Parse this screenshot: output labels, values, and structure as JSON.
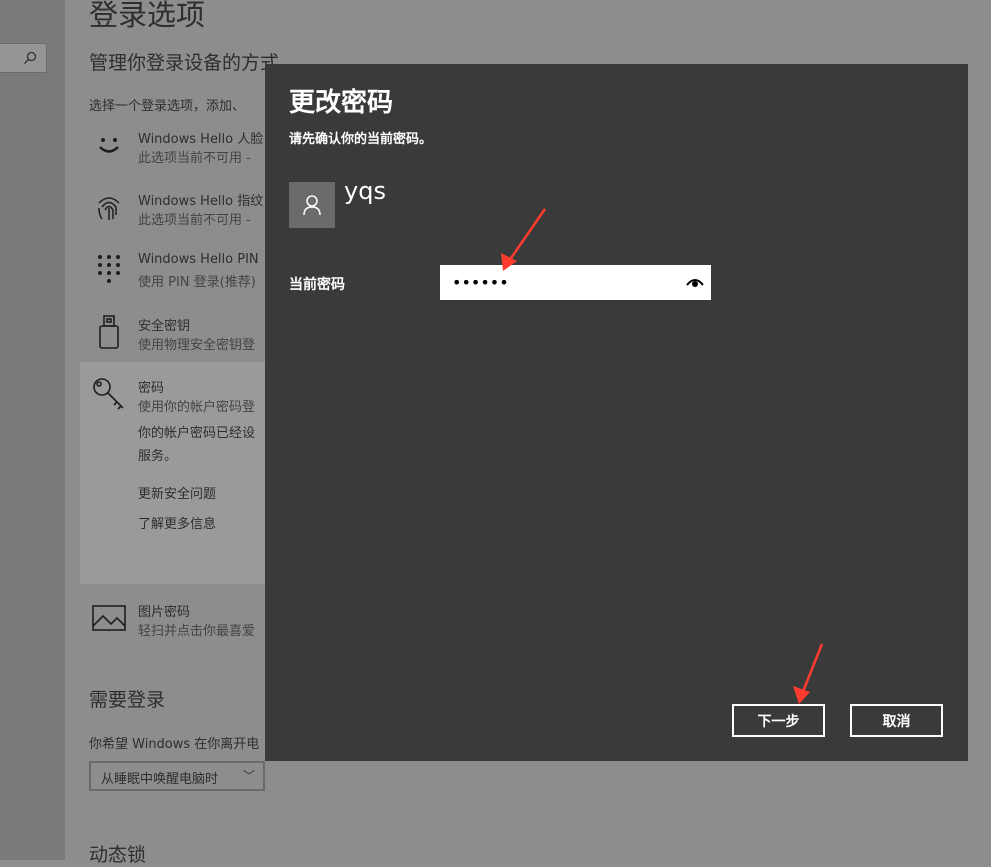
{
  "settings": {
    "title": "登录选项",
    "subtitle": "管理你登录设备的方式",
    "description": "选择一个登录选项，添加、",
    "options": [
      {
        "name": "Windows Hello 人脸",
        "sub": "此选项当前不可用 -",
        "icon": "face-icon"
      },
      {
        "name": "Windows Hello 指纹",
        "sub": "此选项当前不可用 -",
        "icon": "fingerprint-icon"
      },
      {
        "name": "Windows Hello PIN",
        "sub": "使用 PIN 登录(推荐)",
        "icon": "pin-keypad-icon"
      },
      {
        "name": "安全密钥",
        "sub": "使用物理安全密钥登",
        "icon": "security-key-icon"
      },
      {
        "name": "密码",
        "sub": "使用你的帐户密码登",
        "icon": "key-icon"
      },
      {
        "name": "图片密码",
        "sub": "轻扫并点击你最喜爱",
        "icon": "picture-icon"
      }
    ],
    "password_panel": {
      "info_line1": "你的帐户密码已经设",
      "info_line2": "服务。",
      "link1": "更新安全问题",
      "link2": "了解更多信息"
    },
    "require_signin": {
      "title": "需要登录",
      "desc": "你希望 Windows 在你离开电",
      "select_value": "从睡眠中唤醒电脑时"
    },
    "dynamic_lock": "动态锁"
  },
  "dialog": {
    "title": "更改密码",
    "subtitle": "请先确认你的当前密码。",
    "username": "yqs",
    "password_label": "当前密码",
    "password_value": "••••••",
    "next_button": "下一步",
    "cancel_button": "取消"
  },
  "colors": {
    "dialog_bg": "#3a3a3a",
    "annotation_arrow": "#ff3b2f"
  }
}
